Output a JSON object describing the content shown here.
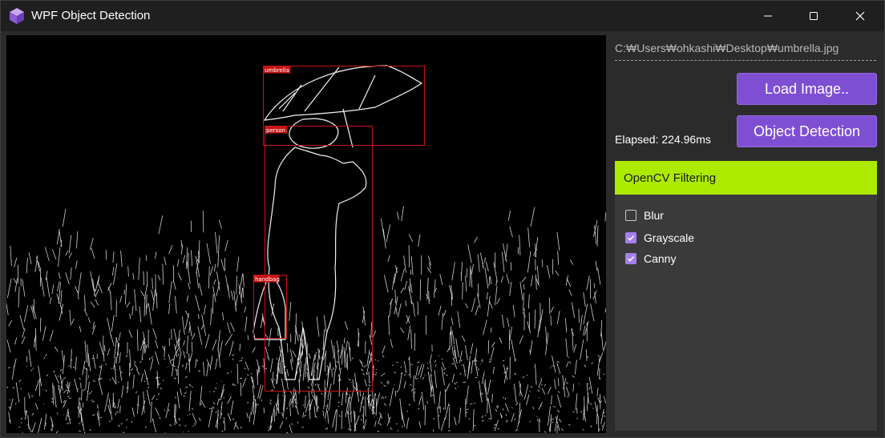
{
  "window": {
    "title": "WPF Object Detection",
    "app_icon": "cube-icon",
    "controls": [
      "minimize-icon",
      "maximize-icon",
      "close-icon"
    ]
  },
  "image_viewer": {
    "detections": [
      {
        "label": "umbrella"
      },
      {
        "label": "person"
      },
      {
        "label": "handbag"
      }
    ],
    "box_color": "#c81414"
  },
  "sidebar": {
    "file_path": "C:₩Users₩ohkashi₩Desktop₩umbrella.jpg",
    "load_button": "Load Image..",
    "detect_button": "Object Detection",
    "elapsed": "Elapsed: 224.96ms",
    "filter_panel": {
      "header": "OpenCV Filtering",
      "options": [
        {
          "label": "Blur",
          "checked": false
        },
        {
          "label": "Grayscale",
          "checked": true
        },
        {
          "label": "Canny",
          "checked": true
        }
      ]
    }
  },
  "colors": {
    "accent_button": "#7e4fd3",
    "header_green": "#acea00",
    "checkbox_checked": "#a57ff0"
  }
}
